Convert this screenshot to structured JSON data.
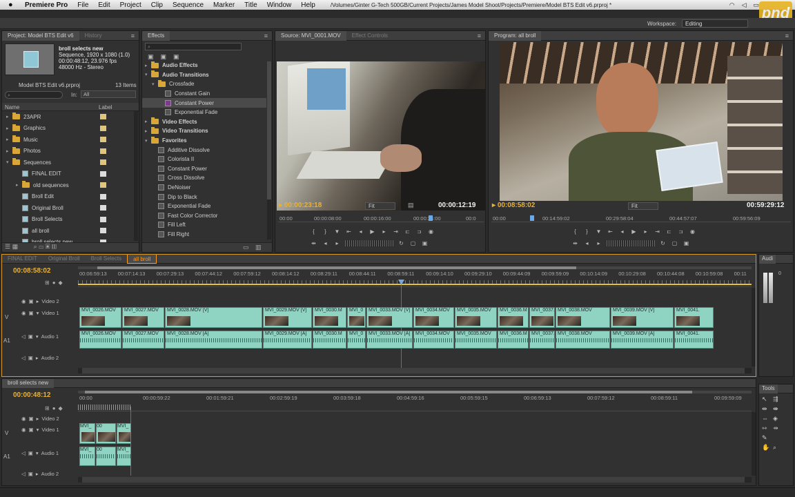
{
  "menubar": {
    "apple": "",
    "app": "Premiere Pro",
    "items": [
      "File",
      "Edit",
      "Project",
      "Clip",
      "Sequence",
      "Marker",
      "Title",
      "Window",
      "Help"
    ],
    "path": "/Volumes/Ginter G-Tech 500GB/Current Projects/James Model Shoot/Projects/Premiere/Model BTS Edit v6.prproj *"
  },
  "workspace": {
    "label": "Workspace:",
    "value": "Editing"
  },
  "project": {
    "tab": "Project: Model BTS Edit v6",
    "tab2": "History",
    "clip_name": "broll selects new",
    "clip_line1": "Sequence, 1920 x 1080 (1.0)",
    "clip_line2": "00:00:48:12, 23.976 fps",
    "clip_line3": "48000 Hz - Stereo",
    "file": "Model BTS Edit v6.prproj",
    "count": "13 Items",
    "in_label": "In:",
    "in_value": "All",
    "col_name": "Name",
    "col_label": "Label",
    "items": [
      {
        "name": "23APR",
        "type": "folder",
        "tri": "▸",
        "color": "#e0c57c"
      },
      {
        "name": "Graphics",
        "type": "folder",
        "tri": "▸",
        "color": "#e0c57c"
      },
      {
        "name": "Music",
        "type": "folder",
        "tri": "▸",
        "color": "#e0c57c"
      },
      {
        "name": "Photos",
        "type": "folder",
        "tri": "▸",
        "color": "#e0c57c"
      },
      {
        "name": "Sequences",
        "type": "folder",
        "tri": "▾",
        "color": "#e0c57c"
      },
      {
        "name": "FINAL EDIT",
        "type": "seq",
        "tri": "",
        "color": "#dcdcdc"
      },
      {
        "name": "old sequences",
        "type": "folder",
        "tri": "▸",
        "color": "#e0c57c"
      },
      {
        "name": "Broll Edit",
        "type": "seq",
        "tri": "",
        "color": "#dcdcdc"
      },
      {
        "name": "Original Broll",
        "type": "seq",
        "tri": "",
        "color": "#dcdcdc"
      },
      {
        "name": "Broll Selects",
        "type": "seq",
        "tri": "",
        "color": "#dcdcdc"
      },
      {
        "name": "all broll",
        "type": "seq",
        "tri": "",
        "color": "#dcdcdc"
      },
      {
        "name": "broll selects new",
        "type": "seq",
        "tri": "",
        "color": "#dcdcdc"
      }
    ]
  },
  "effects": {
    "tab": "Effects",
    "items": [
      {
        "name": "Audio Effects",
        "level": 0,
        "kind": "folder",
        "tri": "▸",
        "bold": true
      },
      {
        "name": "Audio Transitions",
        "level": 0,
        "kind": "folder",
        "tri": "▾",
        "bold": true
      },
      {
        "name": "Crossfade",
        "level": 1,
        "kind": "folder",
        "tri": "▾",
        "bold": false
      },
      {
        "name": "Constant Gain",
        "level": 2,
        "kind": "fx",
        "tri": "",
        "bold": false
      },
      {
        "name": "Constant Power",
        "level": 2,
        "kind": "fxp",
        "tri": "",
        "bold": false
      },
      {
        "name": "Exponential Fade",
        "level": 2,
        "kind": "fx",
        "tri": "",
        "bold": false
      },
      {
        "name": "Video Effects",
        "level": 0,
        "kind": "folder",
        "tri": "▸",
        "bold": true
      },
      {
        "name": "Video Transitions",
        "level": 0,
        "kind": "folder",
        "tri": "▸",
        "bold": true
      },
      {
        "name": "Favorites",
        "level": 0,
        "kind": "folder",
        "tri": "▾",
        "bold": true
      },
      {
        "name": "Additive Dissolve",
        "level": 1,
        "kind": "fx",
        "tri": "",
        "bold": false
      },
      {
        "name": "Colorista II",
        "level": 1,
        "kind": "fx",
        "tri": "",
        "bold": false
      },
      {
        "name": "Constant Power",
        "level": 1,
        "kind": "fx",
        "tri": "",
        "bold": false
      },
      {
        "name": "Cross Dissolve",
        "level": 1,
        "kind": "fx",
        "tri": "",
        "bold": false
      },
      {
        "name": "DeNoiser",
        "level": 1,
        "kind": "fx",
        "tri": "",
        "bold": false
      },
      {
        "name": "Dip to Black",
        "level": 1,
        "kind": "fx",
        "tri": "",
        "bold": false
      },
      {
        "name": "Exponential Fade",
        "level": 1,
        "kind": "fx",
        "tri": "",
        "bold": false
      },
      {
        "name": "Fast Color Corrector",
        "level": 1,
        "kind": "fx",
        "tri": "",
        "bold": false
      },
      {
        "name": "Fill Left",
        "level": 1,
        "kind": "fx",
        "tri": "",
        "bold": false
      },
      {
        "name": "Fill Right",
        "level": 1,
        "kind": "fx",
        "tri": "",
        "bold": false
      }
    ]
  },
  "source": {
    "tab": "Source: MVI_0001.MOV",
    "tab2": "Effect Controls",
    "tc_left": "00:00:23:18",
    "fit": "Fit",
    "tc_right": "00:00:12:19",
    "ruler": [
      "00:00",
      "00:00:08:00",
      "00:00:16:00",
      "00:00:24:00",
      "00:0"
    ]
  },
  "program": {
    "tab": "Program: all broll",
    "tc_left": "00:08:58:02",
    "fit": "Fit",
    "tc_right": "00:59:29:12",
    "ruler": [
      "00:00",
      "00:14:59:02",
      "00:29:58:04",
      "00:44:57:07",
      "00:59:56:09"
    ]
  },
  "timeline1": {
    "tabs": [
      "FINAL EDIT",
      "Original Broll",
      "Broll Selects",
      "all broll"
    ],
    "tc": "00:08:58:02",
    "ruler": [
      "00:06:59:13",
      "00:07:14:13",
      "00:07:29:13",
      "00:07:44:12",
      "00:07:59:12",
      "00:08:14:12",
      "00:08:29:11",
      "00:08:44:11",
      "00:08:59:11",
      "00:09:14:10",
      "00:09:29:10",
      "00:09:44:09",
      "00:09:59:09",
      "00:10:14:09",
      "00:10:29:08",
      "00:10:44:08",
      "00:10:59:08",
      "00:11"
    ],
    "tracks": {
      "v2": "Video 2",
      "v1": "Video 1",
      "a1": "Audio 1",
      "a2": "Audio 2",
      "v": "V",
      "a": "A1"
    },
    "vclips": [
      "MVI_0026.MOV",
      "MVI_0027.MOV",
      "MVI_0028.MOV [V]",
      "MVI_0029.MOV [V]",
      "MVI_0030.M",
      "MVI_0",
      "MVI_0033.MOV [V]",
      "MVI_0034.MOV",
      "MVI_0035.MOV",
      "MVI_0036.M",
      "MVI_0037.",
      "MVI_0038.MOV",
      "MVI_0039.MOV [V]",
      "MVI_0041."
    ],
    "aclips": [
      "MVI_0026.MOV",
      "MVI_0027.MOV",
      "MVI_0028.MOV [A]",
      "MVI_0029.MOV [A]",
      "MVI_0030.M",
      "MVI_0",
      "MVI_0033.MOV [A]",
      "MVI_0034.MOV",
      "MVI_0035.MOV",
      "MVI_0036.M",
      "MVI_0037.",
      "MVI_0038.MOV",
      "MVI_0039.MOV [A]",
      "MVI_0041."
    ]
  },
  "timeline2": {
    "tab": "broll selects new",
    "tc": "00:00:48:12",
    "ruler": [
      "00:00",
      "00:00:59:22",
      "00:01:59:21",
      "00:02:59:19",
      "00:03:59:18",
      "00:04:59:16",
      "00:05:59:15",
      "00:06:59:13",
      "00:07:59:12",
      "00:08:59:11",
      "00:09:59:09"
    ],
    "tracks": {
      "v2": "Video 2",
      "v1": "Video 1",
      "a1": "Audio 1",
      "a2": "Audio 2",
      "v": "V",
      "a": "A1"
    },
    "vclips": [
      "MVI_",
      "00",
      "MVI_"
    ],
    "aclips": [
      "MVI_",
      "00",
      "MVI_"
    ]
  },
  "audio_meter": {
    "tab": "Audi",
    "zero": "0"
  },
  "tools": {
    "tab": "Tools"
  },
  "logo": {
    "text": "pnd"
  }
}
